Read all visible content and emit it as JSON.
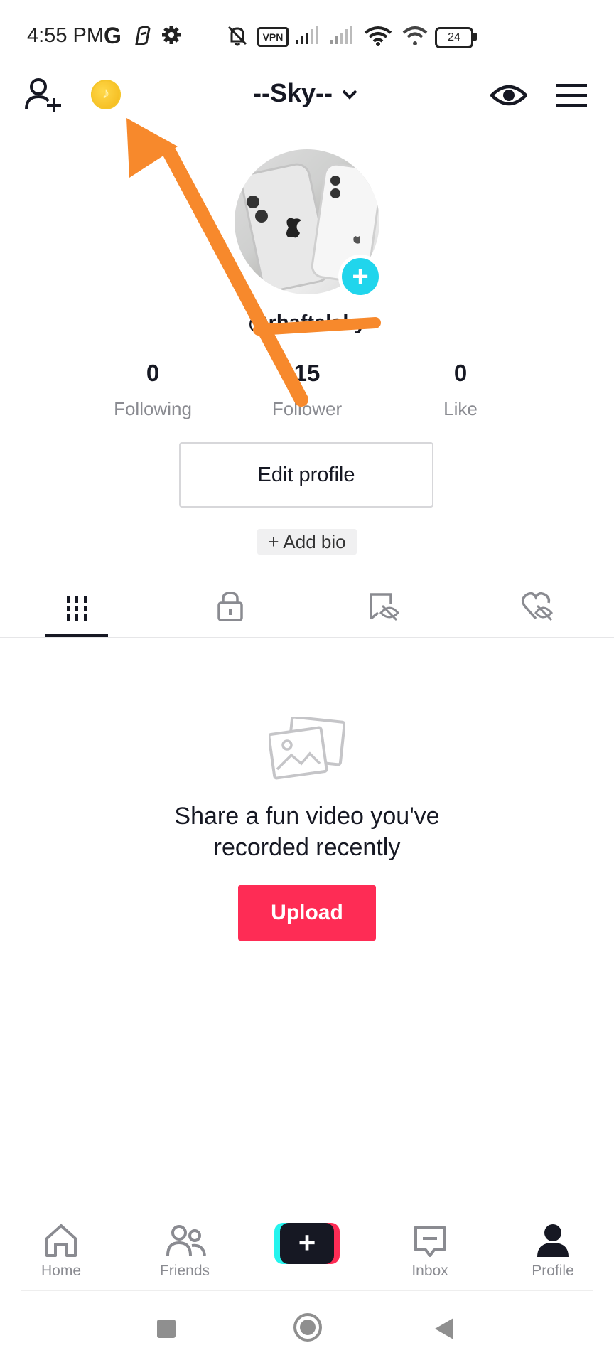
{
  "status_bar": {
    "time": "4:55 PM",
    "carrier_glyph": "G",
    "vpn": "VPN",
    "battery": "24"
  },
  "header": {
    "username": "--Sky--"
  },
  "profile": {
    "handle": "@rhaftalsky",
    "stats": [
      {
        "value": "0",
        "label": "Following"
      },
      {
        "value": "15",
        "label": "Follower"
      },
      {
        "value": "0",
        "label": "Like"
      }
    ],
    "edit_button": "Edit profile",
    "add_bio": "+ Add bio"
  },
  "tabs": [
    {
      "icon": "grid-icon",
      "active": true
    },
    {
      "icon": "lock-icon",
      "active": false
    },
    {
      "icon": "saved-eye-off-icon",
      "active": false
    },
    {
      "icon": "liked-eye-off-icon",
      "active": false
    }
  ],
  "empty_state": {
    "message": "Share a fun video you've recorded recently",
    "upload_button": "Upload"
  },
  "bottom_nav": {
    "items": [
      {
        "label": "Home",
        "icon": "home-icon"
      },
      {
        "label": "Friends",
        "icon": "friends-icon"
      },
      {
        "label": "",
        "icon": "create-plus-icon"
      },
      {
        "label": "Inbox",
        "icon": "inbox-icon"
      },
      {
        "label": "Profile",
        "icon": "profile-icon"
      }
    ]
  },
  "colors": {
    "accent": "#fe2c55",
    "cyan": "#25f4ee",
    "annotation_arrow": "#f7892c",
    "coin": "#f2b413"
  }
}
